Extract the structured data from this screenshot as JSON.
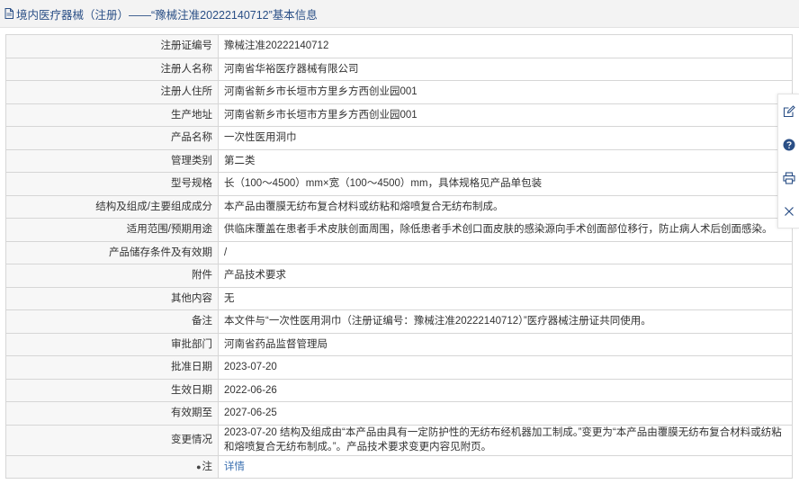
{
  "header": {
    "title": "境内医疗器械（注册）——“豫械注准20222140712”基本信息",
    "icon": "document-icon"
  },
  "rows": [
    {
      "label": "注册证编号",
      "value": "豫械注准20222140712"
    },
    {
      "label": "注册人名称",
      "value": "河南省华裕医疗器械有限公司"
    },
    {
      "label": "注册人住所",
      "value": "河南省新乡市长垣市方里乡方西创业园001"
    },
    {
      "label": "生产地址",
      "value": "河南省新乡市长垣市方里乡方西创业园001"
    },
    {
      "label": "产品名称",
      "value": "一次性医用洞巾"
    },
    {
      "label": "管理类别",
      "value": "第二类"
    },
    {
      "label": "型号规格",
      "value": "长（100～4500）mm×宽（100～4500）mm，具体规格见产品单包装"
    },
    {
      "label": "结构及组成/主要组成成分",
      "value": "本产品由覆膜无纺布复合材料或纺粘和熔喷复合无纺布制成。"
    },
    {
      "label": "适用范围/预期用途",
      "value": "供临床覆盖在患者手术皮肤创面周围，除低患者手术创口面皮肤的感染源向手术创面部位移行，防止病人术后创面感染。"
    },
    {
      "label": "产品储存条件及有效期",
      "value": "/"
    },
    {
      "label": "附件",
      "value": "产品技术要求"
    },
    {
      "label": "其他内容",
      "value": "无"
    },
    {
      "label": "备注",
      "value": "本文件与“一次性医用洞巾（注册证编号：豫械注准20222140712）”医疗器械注册证共同使用。"
    },
    {
      "label": "审批部门",
      "value": "河南省药品监督管理局"
    },
    {
      "label": "批准日期",
      "value": "2023-07-20"
    },
    {
      "label": "生效日期",
      "value": "2022-06-26"
    },
    {
      "label": "有效期至",
      "value": "2027-06-25"
    },
    {
      "label": "变更情况",
      "value": "2023-07-20 结构及组成由“本产品由具有一定防护性的无纺布经机器加工制成。”变更为“本产品由覆膜无纺布复合材料或纺粘和熔喷复合无纺布制成。”。产品技术要求变更内容见附页。"
    }
  ],
  "note": {
    "label": "注",
    "icon": "pin-icon",
    "link_text": "详情"
  },
  "side_tools": [
    "edit-icon",
    "help-icon",
    "print-icon",
    "close-icon"
  ],
  "colors": {
    "header_text": "#2a4f86",
    "link": "#3a6fb0",
    "help_icon": "#2a4f86",
    "border": "#d6d6d6",
    "label_bg": "#f7f7f7"
  }
}
